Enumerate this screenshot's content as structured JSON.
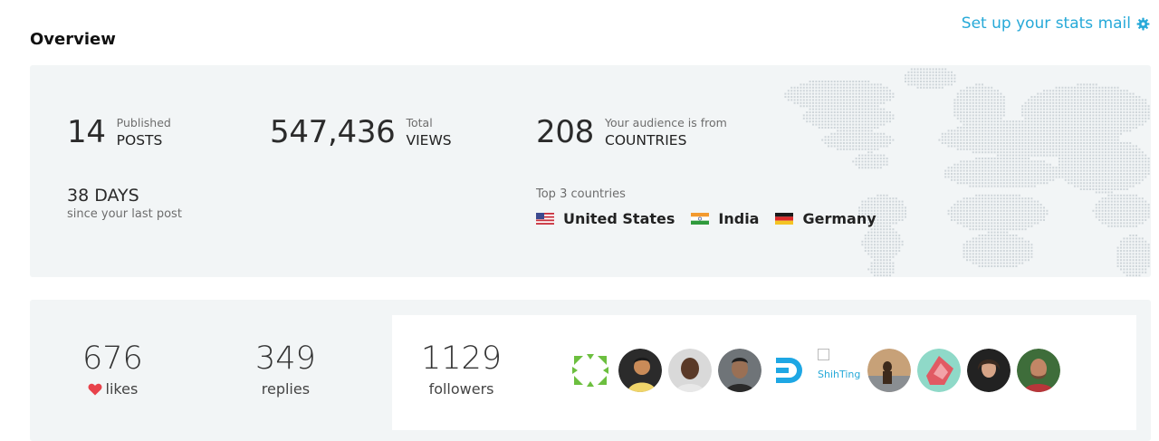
{
  "header": {
    "title": "Overview",
    "mail_link": "Set up your stats mail",
    "accent": "#26a9d8"
  },
  "overview": {
    "posts": {
      "value": "14",
      "small": "Published",
      "caps": "POSTS"
    },
    "views": {
      "value": "547,436",
      "small": "Total",
      "caps": "VIEWS"
    },
    "countries": {
      "value": "208",
      "small": "Your audience is from",
      "caps": "COUNTRIES"
    },
    "last_post": {
      "value": "38 DAYS",
      "caption": "since your last post"
    },
    "top_countries": {
      "label": "Top 3 countries",
      "items": [
        {
          "name": "United States",
          "flag": "us-flag-icon"
        },
        {
          "name": "India",
          "flag": "india-flag-icon"
        },
        {
          "name": "Germany",
          "flag": "germany-flag-icon"
        }
      ]
    }
  },
  "engagement": {
    "likes": {
      "value": "676",
      "label": "likes",
      "icon": "heart-icon",
      "icon_color": "#e8424b"
    },
    "replies": {
      "value": "349",
      "label": "replies"
    },
    "followers": {
      "value": "1129",
      "label": "followers"
    },
    "avatars": [
      {
        "kind": "identicon",
        "color": "#6cbf3f"
      },
      {
        "kind": "photo",
        "bg": "#2b2b2b",
        "face": "#c98b58"
      },
      {
        "kind": "photo",
        "bg": "#d9d9d9",
        "face": "#5a3a28"
      },
      {
        "kind": "photo",
        "bg": "#6f7478",
        "face": "#9a7055"
      },
      {
        "kind": "logo",
        "color": "#1ea7e4"
      },
      {
        "kind": "broken",
        "alt": "ShihTing"
      },
      {
        "kind": "photo",
        "bg": "#c7a178",
        "face": "#3d2a1c"
      },
      {
        "kind": "art",
        "bg": "#8fd9c8",
        "color": "#e15a63"
      },
      {
        "kind": "photo",
        "bg": "#222222",
        "face": "#d6a487"
      },
      {
        "kind": "photo",
        "bg": "#3e6d3a",
        "face": "#c28666"
      }
    ]
  }
}
